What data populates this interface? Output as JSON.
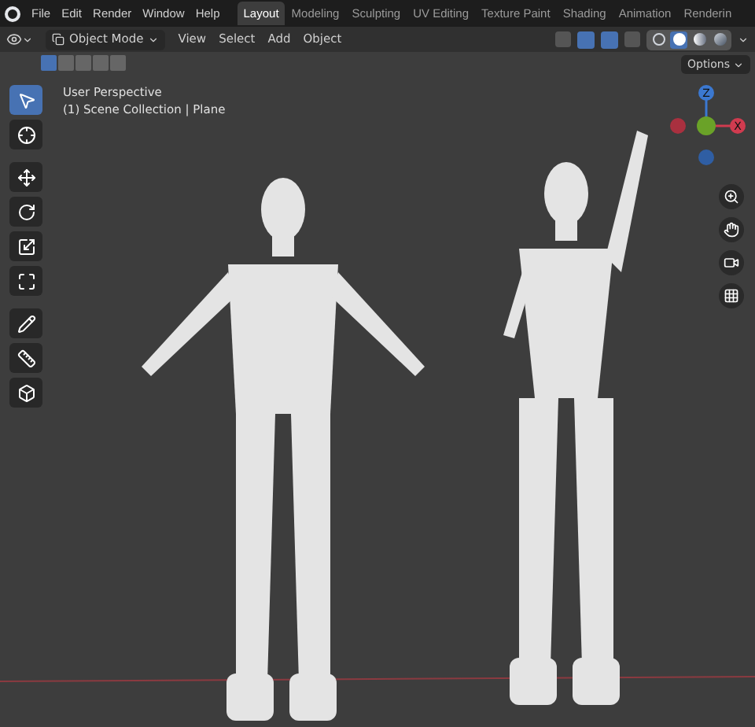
{
  "menu": [
    "File",
    "Edit",
    "Render",
    "Window",
    "Help"
  ],
  "workspaces": [
    {
      "label": "Layout",
      "selected": true
    },
    {
      "label": "Modeling",
      "selected": false
    },
    {
      "label": "Sculpting",
      "selected": false
    },
    {
      "label": "UV Editing",
      "selected": false
    },
    {
      "label": "Texture Paint",
      "selected": false
    },
    {
      "label": "Shading",
      "selected": false
    },
    {
      "label": "Animation",
      "selected": false
    },
    {
      "label": "Renderin",
      "selected": false
    }
  ],
  "mode": "Object Mode",
  "header_menu": [
    "View",
    "Select",
    "Add",
    "Object"
  ],
  "shading": [
    {
      "kind": "wire",
      "selected": false
    },
    {
      "kind": "solid",
      "selected": true
    },
    {
      "kind": "material",
      "selected": false
    },
    {
      "kind": "rendered",
      "selected": false
    }
  ],
  "options": "Options",
  "viewport": {
    "title": "User Perspective",
    "subtitle": "(1) Scene Collection | Plane"
  },
  "tools": [
    {
      "kind": "select",
      "selected": true
    },
    {
      "kind": "cursor",
      "selected": false
    },
    {
      "kind": "move",
      "selected": false
    },
    {
      "kind": "rotate",
      "selected": false
    },
    {
      "kind": "scale",
      "selected": false
    },
    {
      "kind": "transform",
      "selected": false
    },
    {
      "kind": "annotate",
      "selected": false
    },
    {
      "kind": "measure",
      "selected": false
    },
    {
      "kind": "add_cube",
      "selected": false
    }
  ],
  "gizmo": {
    "z": "Z",
    "x": "X"
  }
}
